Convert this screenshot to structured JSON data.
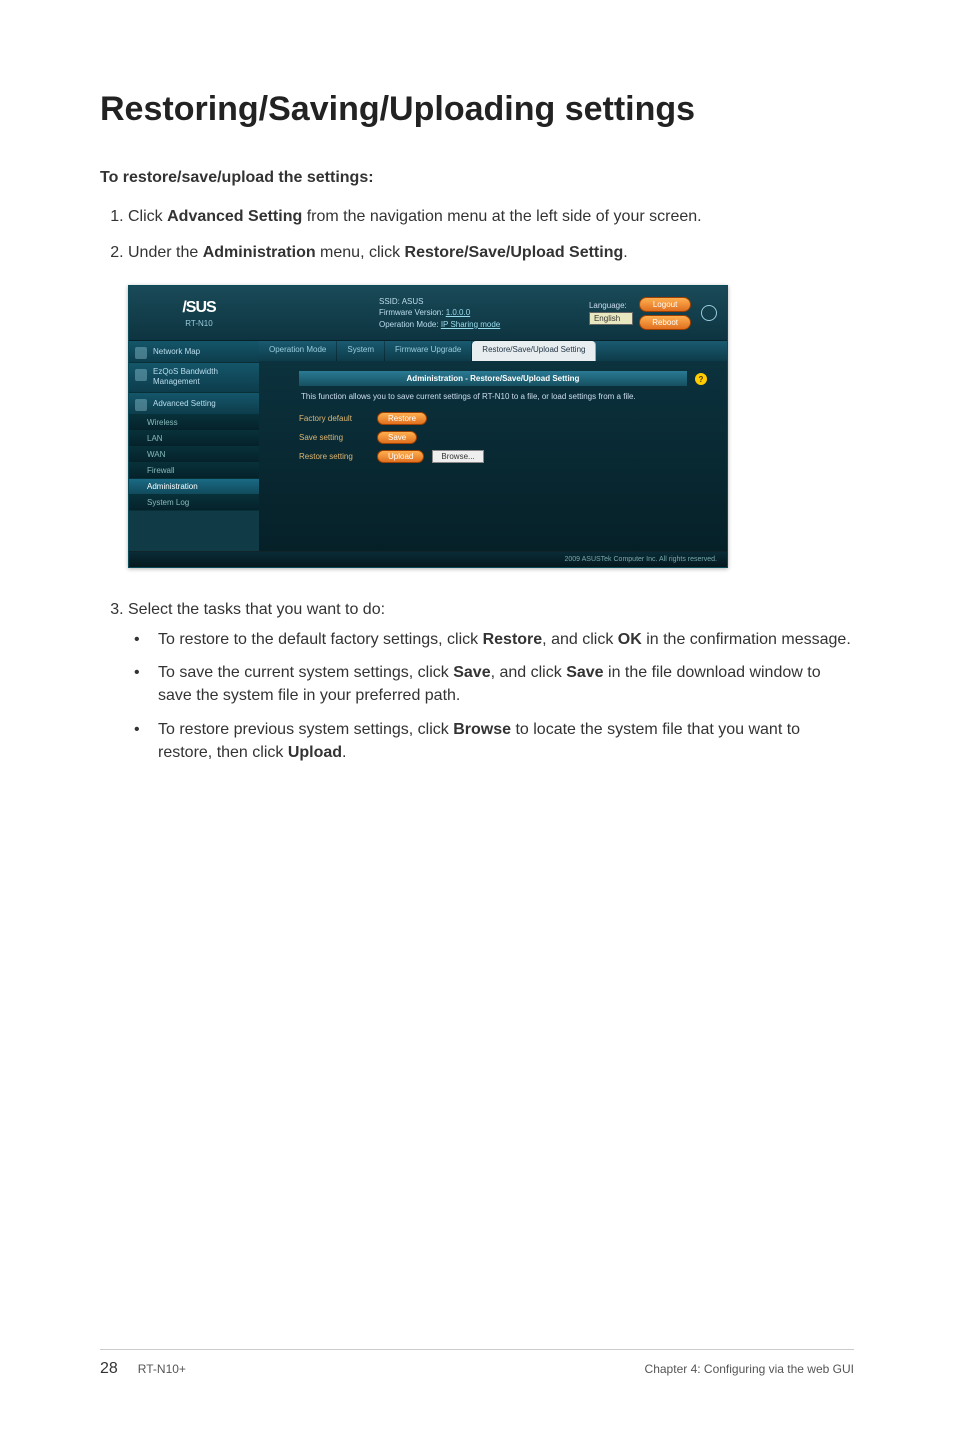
{
  "page": {
    "title": "Restoring/Saving/Uploading settings",
    "subhead": "To restore/save/upload the settings:",
    "step1_pre": "Click ",
    "step1_bold": "Advanced Setting",
    "step1_post": " from the navigation menu at the left side of your screen.",
    "step2_pre": "Under the ",
    "step2_bold1": "Administration",
    "step2_mid": " menu, click ",
    "step2_bold2": "Restore/Save/Upload Setting",
    "step2_post": ".",
    "step3": "Select the tasks that you want to do:",
    "b1_pre": "To restore to the default factory settings, click ",
    "b1_b1": "Restore",
    "b1_mid": ", and click ",
    "b1_b2": "OK",
    "b1_post": " in the confirmation message.",
    "b2_pre": "To save the current system settings, click ",
    "b2_b1": "Save",
    "b2_mid": ", and click ",
    "b2_b2": "Save",
    "b2_post": " in the file download window to save the system file in your preferred path.",
    "b3_pre": "To restore previous system settings, click ",
    "b3_b1": "Browse",
    "b3_mid": " to locate the system file that you want to restore, then click ",
    "b3_b2": "Upload",
    "b3_post": "."
  },
  "footer": {
    "page_num": "28",
    "model": "RT-N10+",
    "chapter": "Chapter 4: Configuring via the web GUI"
  },
  "screenshot": {
    "logo_top": "/SUS",
    "logo_bot": "RT-N10",
    "ssid_label": "SSID: ",
    "ssid": "ASUS",
    "fw_label": "Firmware Version: ",
    "fw": "1.0.0.0",
    "opmode_label": "Operation Mode: ",
    "opmode": "IP Sharing mode",
    "lang_label": "Language:",
    "lang_value": "English",
    "logout": "Logout",
    "reboot": "Reboot",
    "side": {
      "network_map": "Network Map",
      "ezqos": "EzQoS Bandwidth Management",
      "adv": "Advanced Setting",
      "wireless": "Wireless",
      "lan": "LAN",
      "wan": "WAN",
      "firewall": "Firewall",
      "admin": "Administration",
      "syslog": "System Log"
    },
    "tabs": {
      "opmode": "Operation Mode",
      "system": "System",
      "fw": "Firmware Upgrade",
      "restore": "Restore/Save/Upload Setting"
    },
    "panel": {
      "title": "Administration - Restore/Save/Upload Setting",
      "desc": "This function allows you to save current settings of RT-N10 to a file, or load settings from a file.",
      "row1_lbl": "Factory default",
      "row1_btn": "Restore",
      "row2_lbl": "Save setting",
      "row2_btn": "Save",
      "row3_lbl": "Restore setting",
      "row3_btn": "Upload",
      "row3_browse": "Browse..."
    },
    "copyright": "2009 ASUSTek Computer Inc. All rights reserved."
  }
}
